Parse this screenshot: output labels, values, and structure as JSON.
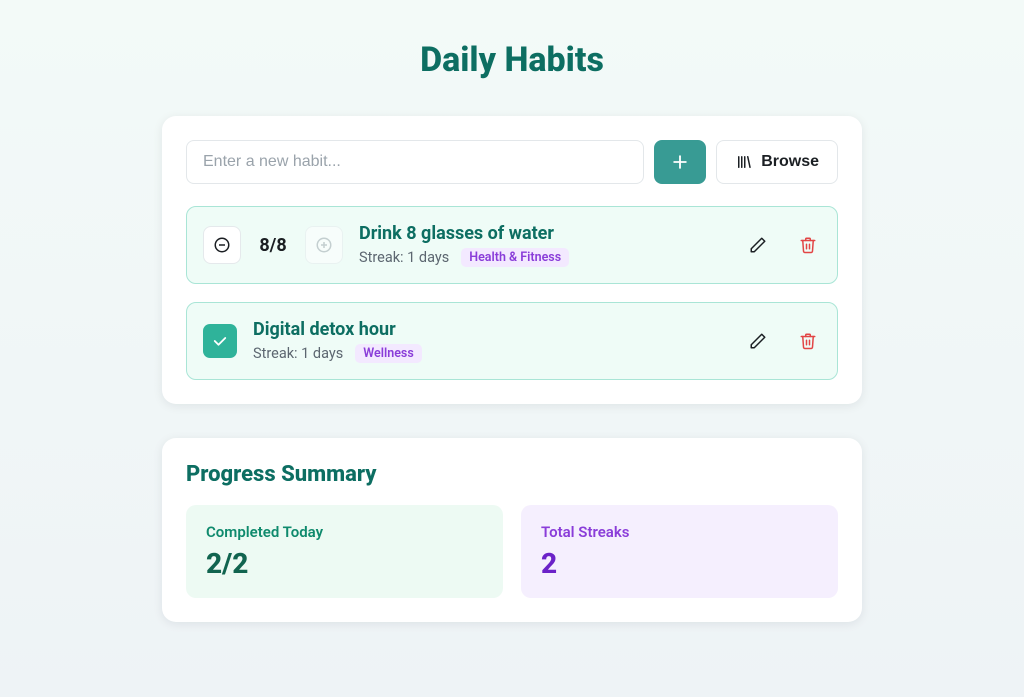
{
  "title": "Daily Habits",
  "input": {
    "placeholder": "Enter a new habit...",
    "browse_label": "Browse"
  },
  "habits": [
    {
      "counter": "8/8",
      "title": "Drink 8 glasses of water",
      "streak": "Streak: 1 days",
      "tag": "Health & Fitness"
    },
    {
      "title": "Digital detox hour",
      "streak": "Streak: 1 days",
      "tag": "Wellness"
    }
  ],
  "summary": {
    "title": "Progress Summary",
    "completed": {
      "label": "Completed Today",
      "value": "2/2"
    },
    "streaks": {
      "label": "Total Streaks",
      "value": "2"
    }
  }
}
